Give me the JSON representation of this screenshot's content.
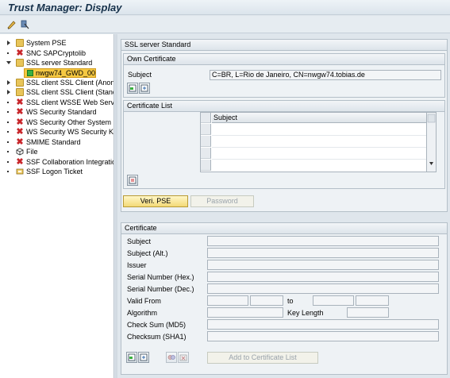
{
  "window": {
    "title": "Trust Manager: Display"
  },
  "toolbar": {
    "icons": [
      "edit-icon",
      "assign-icon"
    ]
  },
  "tree": {
    "items": [
      {
        "label": "System PSE",
        "icon": "folder-icon",
        "state": "collapsed"
      },
      {
        "label": "SNC SAPCryptolib",
        "icon": "x-icon",
        "state": "leaf"
      },
      {
        "label": "SSL server Standard",
        "icon": "folder-icon",
        "state": "expanded"
      },
      {
        "label": "SSL client SSL Client (Anonym",
        "icon": "folder-icon",
        "state": "collapsed"
      },
      {
        "label": "SSL client SSL Client (Standa",
        "icon": "folder-icon",
        "state": "collapsed"
      },
      {
        "label": "SSL client WSSE Web Servic",
        "icon": "x-icon",
        "state": "leaf"
      },
      {
        "label": "WS Security Standard",
        "icon": "x-icon",
        "state": "leaf"
      },
      {
        "label": "WS Security Other System E",
        "icon": "x-icon",
        "state": "leaf"
      },
      {
        "label": "WS Security WS Security Ke",
        "icon": "x-icon",
        "state": "leaf"
      },
      {
        "label": "SMIME Standard",
        "icon": "x-icon",
        "state": "leaf"
      },
      {
        "label": "File",
        "icon": "file-icon",
        "state": "leaf"
      },
      {
        "label": "SSF Collaboration Integration",
        "icon": "x-icon",
        "state": "leaf"
      },
      {
        "label": "SSF Logon Ticket",
        "icon": "ticket-icon",
        "state": "leaf"
      }
    ],
    "selected": {
      "label": "nwgw74_GWD_00",
      "icon": "green-square-icon"
    }
  },
  "ssl_panel": {
    "title": "SSL server Standard",
    "own_cert": {
      "title": "Own Certificate",
      "subject_label": "Subject",
      "subject_value": "C=BR, L=Rio de Janeiro, CN=nwgw74.tobias.de"
    },
    "cert_list": {
      "title": "Certificate List",
      "column": "Subject"
    },
    "buttons": {
      "veri_pse": "Veri. PSE",
      "password": "Password"
    }
  },
  "certificate": {
    "title": "Certificate",
    "labels": {
      "subject": "Subject",
      "subject_alt": "Subject (Alt.)",
      "issuer": "Issuer",
      "serial_hex": "Serial Number (Hex.)",
      "serial_dec": "Serial Number (Dec.)",
      "valid_from": "Valid From",
      "to": "to",
      "algorithm": "Algorithm",
      "key_length": "Key Length",
      "checksum_md5": "Check Sum (MD5)",
      "checksum_sha1": "Checksum (SHA1)"
    },
    "add_button": "Add to Certificate List"
  },
  "colors": {
    "accent": "#f5c842",
    "error": "#c8262b",
    "ok": "#3ab040"
  }
}
